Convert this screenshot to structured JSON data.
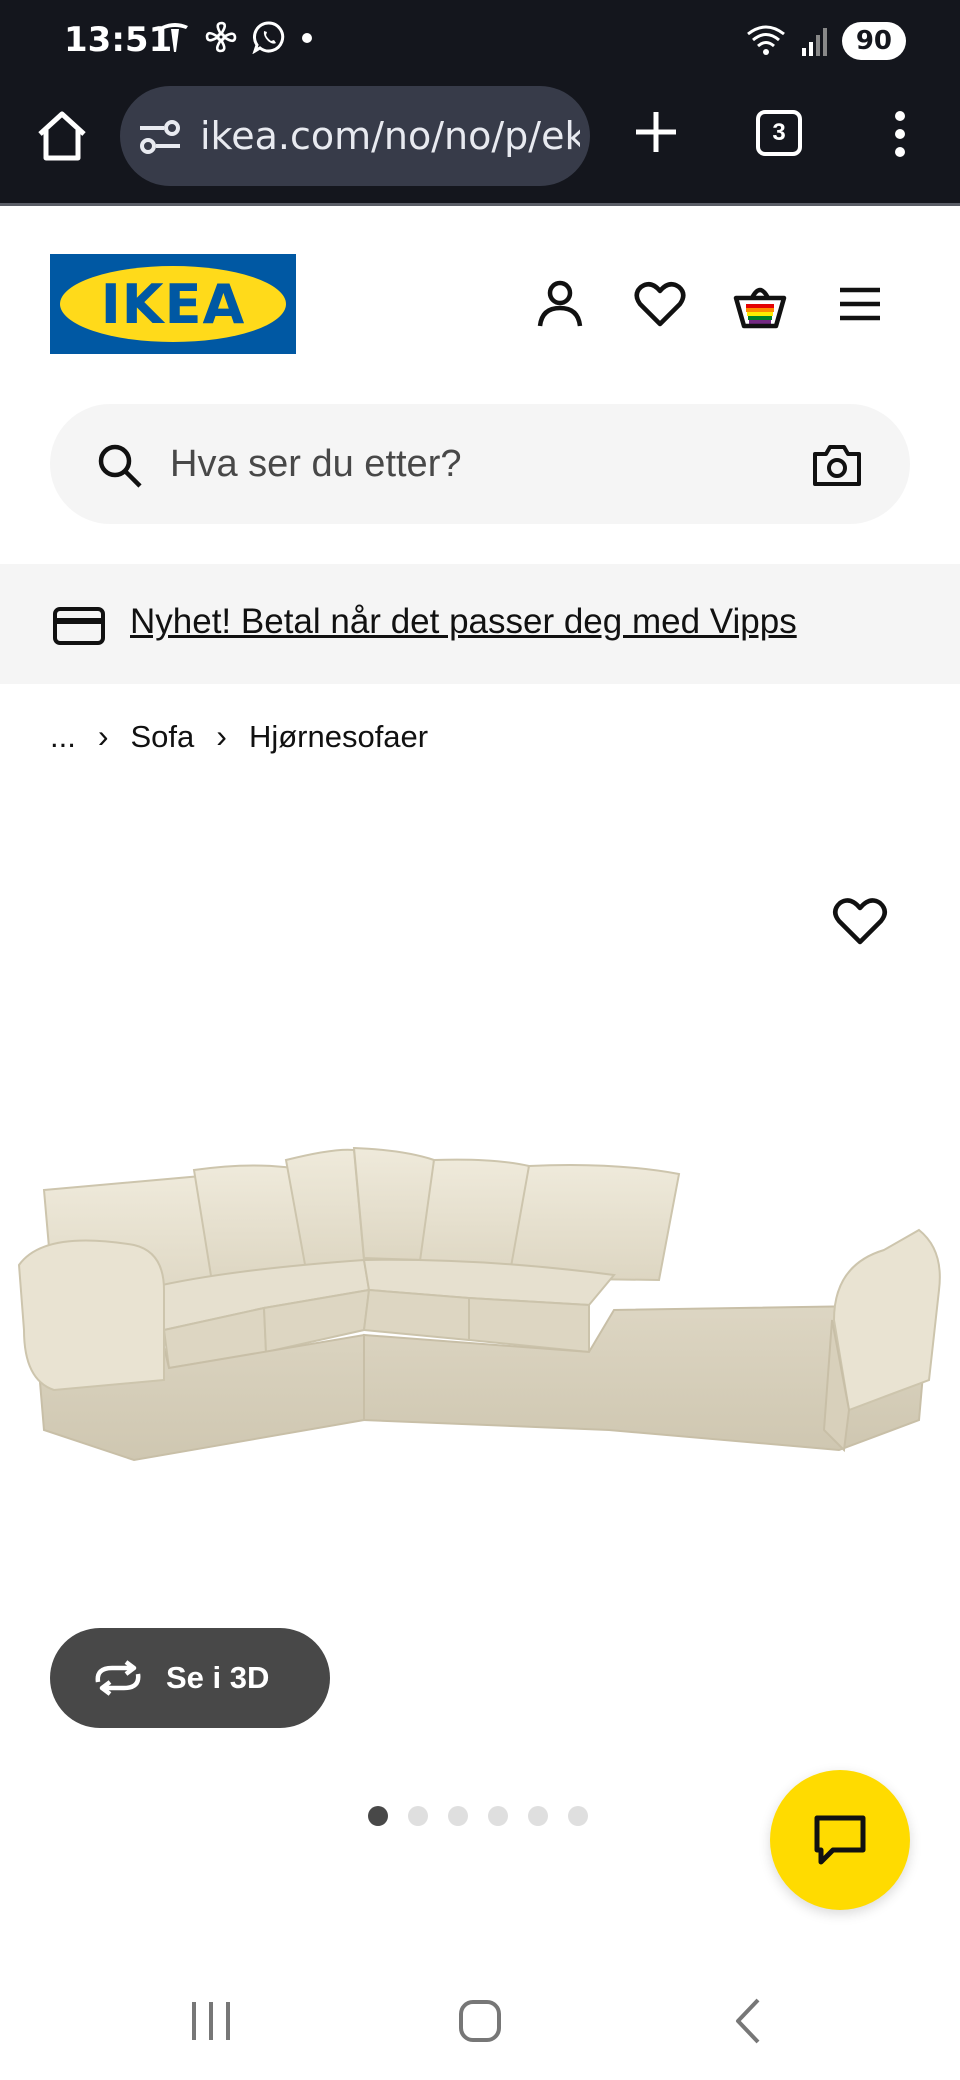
{
  "status_bar": {
    "time": "13:51",
    "battery": "90"
  },
  "browser": {
    "url": "ikea.com/no/no/p/ekt",
    "tab_count": "3"
  },
  "header": {
    "logo_text": "IKEA"
  },
  "search": {
    "placeholder": "Hva ser du etter?"
  },
  "promo": {
    "text": "Nyhet! Betal når det passer deg med Vipps"
  },
  "breadcrumb": {
    "ellipsis": "...",
    "items": [
      "Sofa",
      "Hjørnesofaer"
    ]
  },
  "product": {
    "view_3d_label": "Se i 3D",
    "image_count": 6,
    "active_image": 1,
    "sofa_color": "#e9e3d2"
  },
  "colors": {
    "ikea_blue": "#0058a3",
    "ikea_yellow": "#ffda1a",
    "chat_yellow": "#ffdb00"
  }
}
